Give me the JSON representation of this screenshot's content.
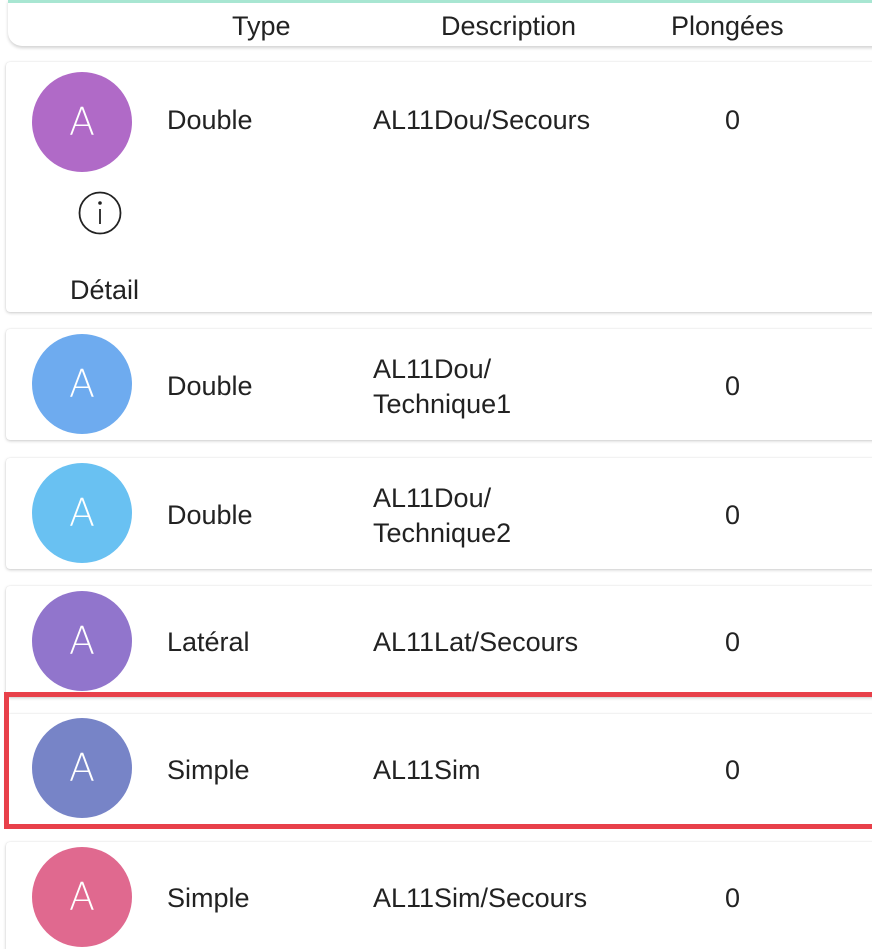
{
  "header": {
    "type": "Type",
    "description": "Description",
    "plongees": "Plongées"
  },
  "rows": [
    {
      "avatar": "A",
      "avatar_color": "#b06ac7",
      "type": "Double",
      "description_line1": "AL11Dou/Secours",
      "description_line2": "",
      "plongees": "0",
      "expanded": true,
      "detail_label": "Détail",
      "detail_icon": "info-icon"
    },
    {
      "avatar": "A",
      "avatar_color": "#6eabef",
      "type": "Double",
      "description_line1": "AL11Dou/",
      "description_line2": "Technique1",
      "plongees": "0"
    },
    {
      "avatar": "A",
      "avatar_color": "#69c1f2",
      "type": "Double",
      "description_line1": "AL11Dou/",
      "description_line2": "Technique2",
      "plongees": "0"
    },
    {
      "avatar": "A",
      "avatar_color": "#9175cc",
      "type": "Latéral",
      "description_line1": "AL11Lat/Secours",
      "description_line2": "",
      "plongees": "0"
    },
    {
      "avatar": "A",
      "avatar_color": "#7784c7",
      "type": "Simple",
      "description_line1": "AL11Sim",
      "description_line2": "",
      "plongees": "0",
      "highlighted": true
    },
    {
      "avatar": "A",
      "avatar_color": "#e0698f",
      "type": "Simple",
      "description_line1": "AL11Sim/Secours",
      "description_line2": "",
      "plongees": "0"
    }
  ],
  "highlight_color": "#e8404a"
}
